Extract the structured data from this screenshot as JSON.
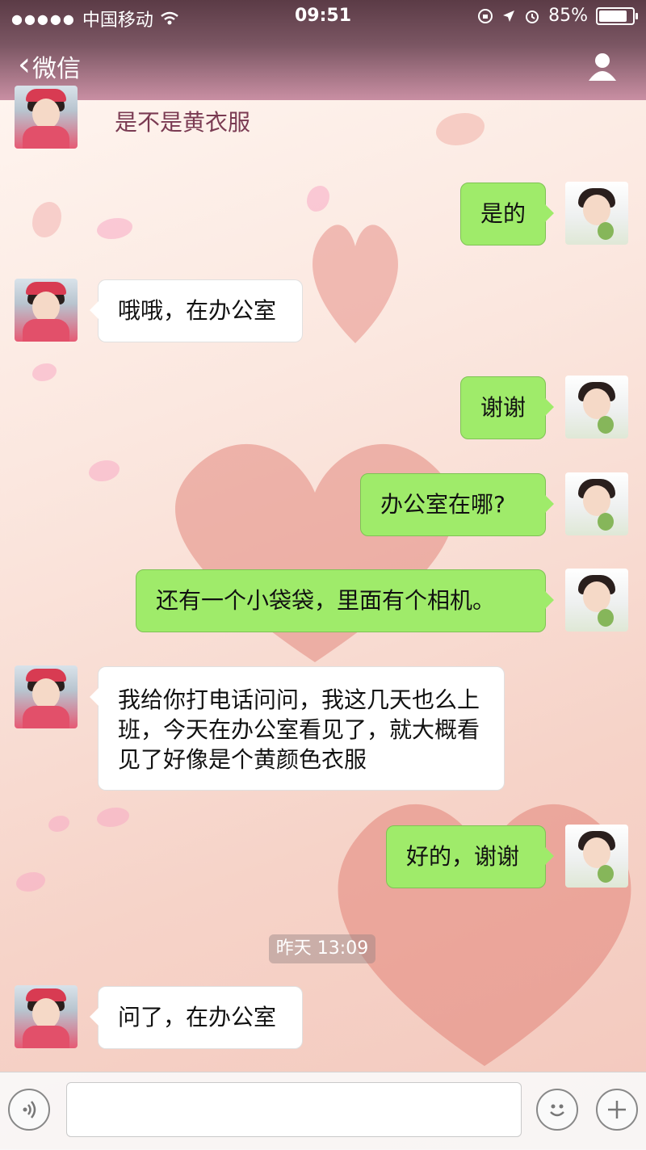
{
  "status_bar": {
    "carrier": "中国移动",
    "time": "09:51",
    "battery": "85%"
  },
  "nav": {
    "back_label": "微信"
  },
  "messages": [
    {
      "side": "left",
      "text": "是不是黄衣服"
    },
    {
      "side": "right",
      "text": "是的"
    },
    {
      "side": "left",
      "text": "哦哦，在办公室"
    },
    {
      "side": "right",
      "text": "谢谢"
    },
    {
      "side": "right",
      "text": "办公室在哪?"
    },
    {
      "side": "right",
      "text": "还有一个小袋袋，里面有个相机。"
    },
    {
      "side": "left",
      "text": "我给你打电话问问，我这几天也么上班，今天在办公室看见了，就大概看见了好像是个黄颜色衣服"
    },
    {
      "side": "right",
      "text": "好的，谢谢"
    },
    {
      "side": "left",
      "text": "问了，在办公室"
    }
  ],
  "timestamp": "昨天 13:09",
  "input": {
    "value": "",
    "placeholder": ""
  },
  "icons": {
    "back": "chevron-left-icon",
    "profile": "person-icon",
    "voice": "voice-icon",
    "emoji": "emoji-icon",
    "plus": "plus-icon"
  },
  "colors": {
    "sent_bubble": "#9feb6a",
    "received_bubble": "#ffffff",
    "header": "#7b5663"
  }
}
